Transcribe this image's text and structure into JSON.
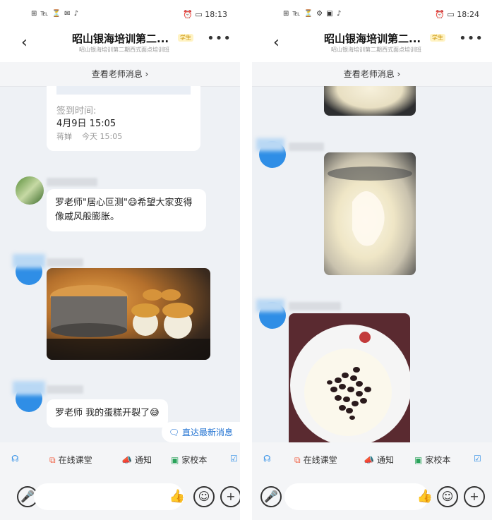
{
  "left": {
    "status": {
      "left_icons": "⊞ ℡ ⏳ ✉ ♪",
      "right_icons": "⏰ ▭",
      "time": "18:13"
    },
    "nav": {
      "title": "昭山银海培训第二...",
      "badge": "学生",
      "subtitle": "昭山银海培训第二期西式面点培训班"
    },
    "teacher_link": "查看老师消息 ›",
    "signin": {
      "label": "签到时间:",
      "datetime": "4月9日 15:05",
      "signer": "蒋婵",
      "time_today": "今天 15:05"
    },
    "msg1": {
      "text": "罗老师\"居心叵测\"😄希望大家变得像戚风般膨胀。"
    },
    "msg3": {
      "text": "罗老师 我的蛋糕开裂了😅"
    },
    "jump_latest": "直达最新消息"
  },
  "right": {
    "status": {
      "left_icons": "⊞ ℡ ⏳ ⚙ ▣ ♪",
      "right_icons": "⏰ ▭",
      "time": "18:24"
    },
    "nav": {
      "title": "昭山银海培训第二...",
      "badge": "学生",
      "subtitle": "昭山银海培训第二期西式面点培训班"
    },
    "teacher_link": "查看老师消息 ›"
  },
  "toolbar": {
    "items": [
      {
        "icon": "headset",
        "label": ""
      },
      {
        "icon": "classroom",
        "label": "在线课堂"
      },
      {
        "icon": "megaphone",
        "label": "通知"
      },
      {
        "icon": "book",
        "label": "家校本"
      },
      {
        "icon": "checkbox",
        "label": ""
      }
    ]
  },
  "colors": {
    "accent": "#2f8ee6",
    "link": "#1c6fd1",
    "bg": "#eef1f5"
  }
}
